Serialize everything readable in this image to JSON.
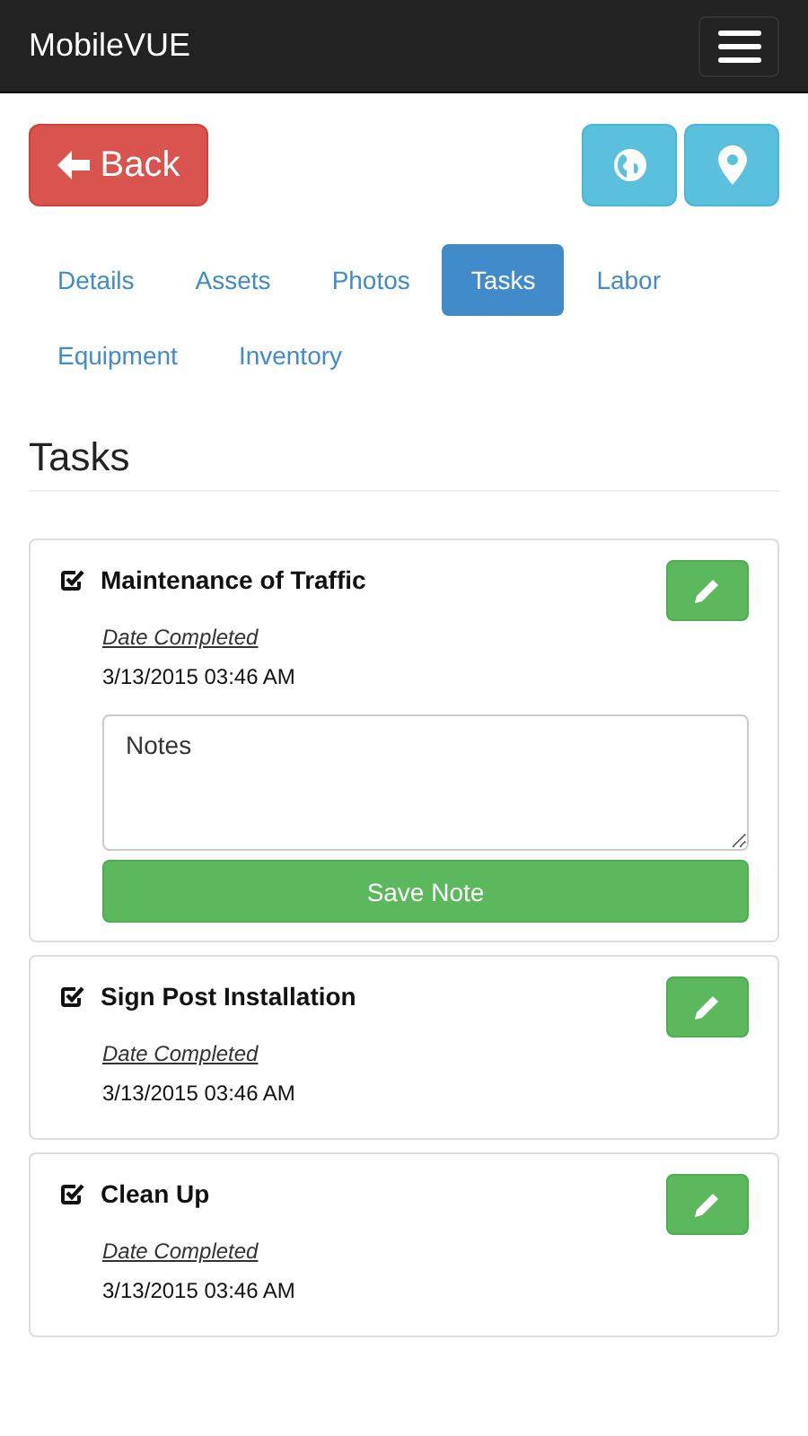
{
  "navbar": {
    "brand": "MobileVUE"
  },
  "back_button": {
    "label": "Back"
  },
  "tabs": [
    {
      "label": "Details",
      "selected": false
    },
    {
      "label": "Assets",
      "selected": false
    },
    {
      "label": "Photos",
      "selected": false
    },
    {
      "label": "Tasks",
      "selected": true
    },
    {
      "label": "Labor",
      "selected": false
    },
    {
      "label": "Equipment",
      "selected": false
    },
    {
      "label": "Inventory",
      "selected": false
    }
  ],
  "heading": "Tasks",
  "tasks": [
    {
      "title": "Maintenance of Traffic",
      "checked": true,
      "date_label": "Date Completed",
      "date": "3/13/2015 03:46 AM",
      "expanded": true,
      "notes": {
        "placeholder": "Notes"
      },
      "save_label": "Save Note"
    },
    {
      "title": "Sign Post Installation",
      "checked": true,
      "date_label": "Date Completed",
      "date": "3/13/2015 03:46 AM",
      "expanded": false
    },
    {
      "title": "Clean Up",
      "checked": true,
      "date_label": "Date Completed",
      "date": "3/13/2015 03:46 AM",
      "expanded": false
    }
  ]
}
